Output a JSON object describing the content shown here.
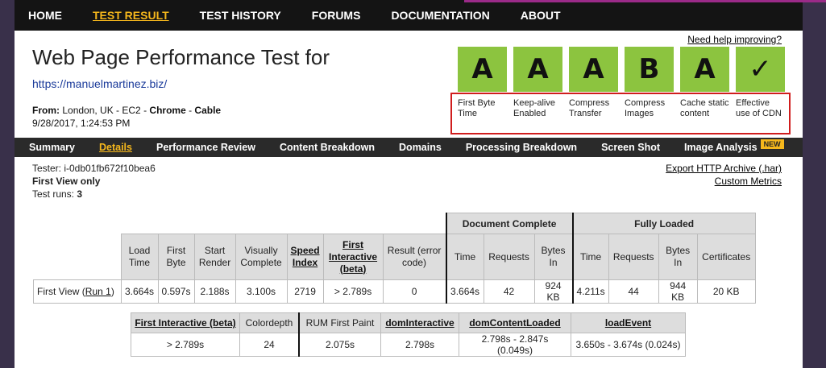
{
  "topnav": [
    "HOME",
    "TEST RESULT",
    "TEST HISTORY",
    "FORUMS",
    "DOCUMENTATION",
    "ABOUT"
  ],
  "header": {
    "title": "Web Page Performance Test for",
    "url": "https://manuelmartinez.biz/",
    "from_label": "From:",
    "from_value": "London, UK - EC2 - ",
    "browser": "Chrome",
    "sep": " - ",
    "connection": "Cable",
    "date": "9/28/2017, 1:24:53 PM",
    "need_help": "Need help improving?"
  },
  "grades": [
    {
      "grade": "A",
      "label": "First Byte Time"
    },
    {
      "grade": "A",
      "label": "Keep-alive Enabled"
    },
    {
      "grade": "A",
      "label": "Compress Transfer"
    },
    {
      "grade": "B",
      "label": "Compress Images"
    },
    {
      "grade": "A",
      "label": "Cache static content"
    },
    {
      "grade": "✓",
      "label": "Effective use of CDN"
    }
  ],
  "grade_color": "#8cc43f",
  "subnav": [
    "Summary",
    "Details",
    "Performance Review",
    "Content Breakdown",
    "Domains",
    "Processing Breakdown",
    "Screen Shot",
    "Image Analysis"
  ],
  "new_badge": "NEW",
  "tester": {
    "tester": "Tester: i-0db01fb672f10bea6",
    "view": "First View only",
    "runs_label": "Test runs: ",
    "runs": "3"
  },
  "links": {
    "export": "Export HTTP Archive (.har)",
    "custom": "Custom Metrics"
  },
  "table1": {
    "group_doc": "Document Complete",
    "group_full": "Fully Loaded",
    "headers": [
      "Load Time",
      "First Byte",
      "Start Render",
      "Visually Complete",
      "Speed Index",
      "First Interactive (beta)",
      "Result (error code)",
      "Time",
      "Requests",
      "Bytes In",
      "Time",
      "Requests",
      "Bytes In",
      "Certificates"
    ],
    "row_label": "First View (",
    "run_link": "Run 1",
    "row_end": ")",
    "values": [
      "3.664s",
      "0.597s",
      "2.188s",
      "3.100s",
      "2719",
      "> 2.789s",
      "0",
      "3.664s",
      "42",
      "924 KB",
      "4.211s",
      "44",
      "944 KB",
      "20 KB"
    ]
  },
  "table2": {
    "headers": [
      "First Interactive (beta)",
      "Colordepth",
      "RUM First Paint",
      "domInteractive",
      "domContentLoaded",
      "loadEvent"
    ],
    "values": [
      "> 2.789s",
      "24",
      "2.075s",
      "2.798s",
      "2.798s - 2.847s (0.049s)",
      "3.650s - 3.674s (0.024s)"
    ]
  }
}
